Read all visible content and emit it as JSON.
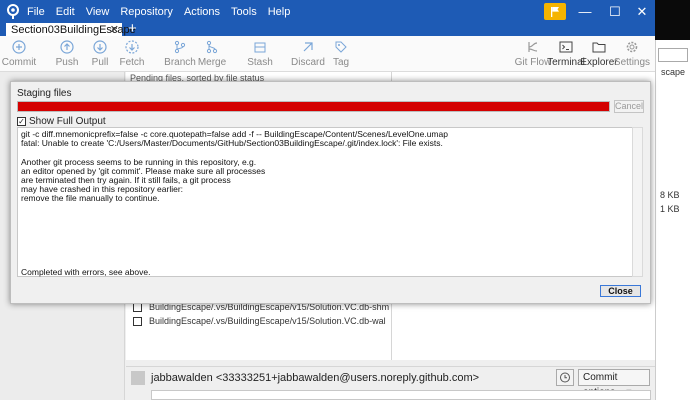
{
  "menu": [
    "File",
    "Edit",
    "View",
    "Repository",
    "Actions",
    "Tools",
    "Help"
  ],
  "window": {
    "minimize": "—",
    "maximize": "☐",
    "close": "✕"
  },
  "tab": {
    "label": "Section03BuildingEscape",
    "close": "✕",
    "add": "+"
  },
  "toolbar": {
    "commit": "Commit",
    "push": "Push",
    "pull": "Pull",
    "fetch": "Fetch",
    "branch": "Branch",
    "merge": "Merge",
    "stash": "Stash",
    "discard": "Discard",
    "tag": "Tag",
    "gitflow": "Git Flow",
    "terminal": "Terminal",
    "explorer": "Explorer",
    "settings": "Settings"
  },
  "background": {
    "pending_header": "Pending files, sorted by file status",
    "files": [
      "BuildingEscape/.vs/BuildingEscape/v15/Solution.VC.db-shm",
      "BuildingEscape/.vs/BuildingEscape/v15/Solution.VC.db-wal"
    ],
    "author": "jabbawalden <33333251+jabbawalden@users.noreply.github.com>",
    "commit_options": "Commit options... ▾",
    "side_escape": "scape",
    "side_size1": "8 KB",
    "side_size2": "1 KB"
  },
  "dialog": {
    "title": "Staging files",
    "progress": 1.0,
    "cancel": "Cancel",
    "show_full_output": "Show Full Output",
    "show_full_output_checked": "✓",
    "output_lines": [
      "git -c diff.mnemonicprefix=false -c core.quotepath=false add -f -- BuildingEscape/Content/Scenes/LevelOne.umap",
      "fatal: Unable to create 'C:/Users/Master/Documents/GitHub/Section03BuildingEscape/.git/index.lock': File exists.",
      "",
      "Another git process seems to be running in this repository, e.g.",
      "an editor opened by 'git commit'. Please make sure all processes",
      "are terminated then try again. If it still fails, a git process",
      "may have crashed in this repository earlier:",
      "remove the file manually to continue.",
      "",
      "",
      "",
      "",
      "",
      "",
      "",
      "Completed with errors, see above."
    ],
    "close": "Close"
  },
  "colors": {
    "titlebar": "#1e5bb5",
    "progress": "#d40000",
    "flag": "#f5b400"
  }
}
